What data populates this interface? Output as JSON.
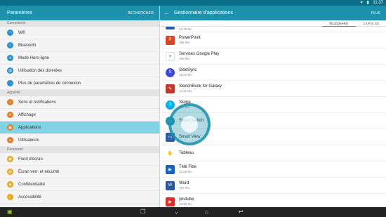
{
  "status": {
    "time": "11:37"
  },
  "left": {
    "title": "Paramètres",
    "action": "RECHERCHER",
    "sections": [
      {
        "label": "Connexions",
        "items": [
          "Wifi",
          "Bluetooth",
          "Mode Hors-ligne",
          "Utilisation des données",
          "Plus de paramètres de connexion"
        ]
      },
      {
        "label": "Appareil",
        "items": [
          "Sons et notifications",
          "Affichage",
          "Applications",
          "Utilisateurs"
        ]
      },
      {
        "label": "Personnel",
        "items": [
          "Fond d'écran",
          "Écran verr. et sécurité",
          "Confidentialité",
          "Accessibilité"
        ]
      }
    ]
  },
  "right": {
    "title": "Gestionnaire d'applications",
    "action": "PLUS",
    "tabs": [
      "TÉLÉCHARG.",
      "CARTE SD"
    ],
    "partial_size": "43,79 Mo",
    "apps": [
      {
        "name": "PowerPoint",
        "size": "194 Mo"
      },
      {
        "name": "Services Google Play",
        "size": "160 Mo"
      },
      {
        "name": "SideSync",
        "size": "18,03 Mo"
      },
      {
        "name": "SketchBook for Galaxy",
        "size": "14,11 Mo"
      },
      {
        "name": "Skype",
        "size": "104 Mo"
      },
      {
        "name": "Smart Switch",
        "size": ""
      },
      {
        "name": "Smart View",
        "size": ""
      },
      {
        "name": "Tableau",
        "size": ""
      },
      {
        "name": "Télé Fibe",
        "size": "42,96 Mo"
      },
      {
        "name": "Word",
        "size": "197 Mo"
      },
      {
        "name": "youtube",
        "size": "43,59 Mo"
      }
    ]
  },
  "colors": {
    "accent": "#1e92ad",
    "selected": "#7fd3e5"
  }
}
